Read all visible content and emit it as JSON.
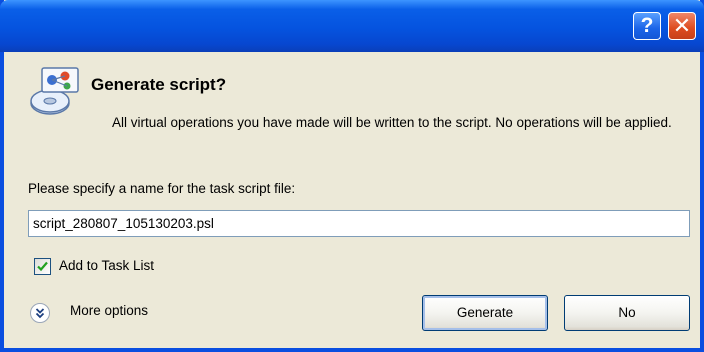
{
  "window": {
    "help_label": "?",
    "close_label": "✕"
  },
  "dialog": {
    "title": "Generate script?",
    "description": "All virtual operations you have made will be written to the script. No operations will be applied.",
    "icon": "script-disk-icon"
  },
  "form": {
    "name_label": "Please specify a name for the task script file:",
    "name_value": "script_280807_105130203.psl",
    "add_to_task_list_label": "Add to Task List",
    "add_to_task_list_checked": true
  },
  "footer": {
    "more_options_label": "More options",
    "more_options_icon": "double-chevron-down-icon",
    "generate_label": "Generate",
    "no_label": "No"
  }
}
